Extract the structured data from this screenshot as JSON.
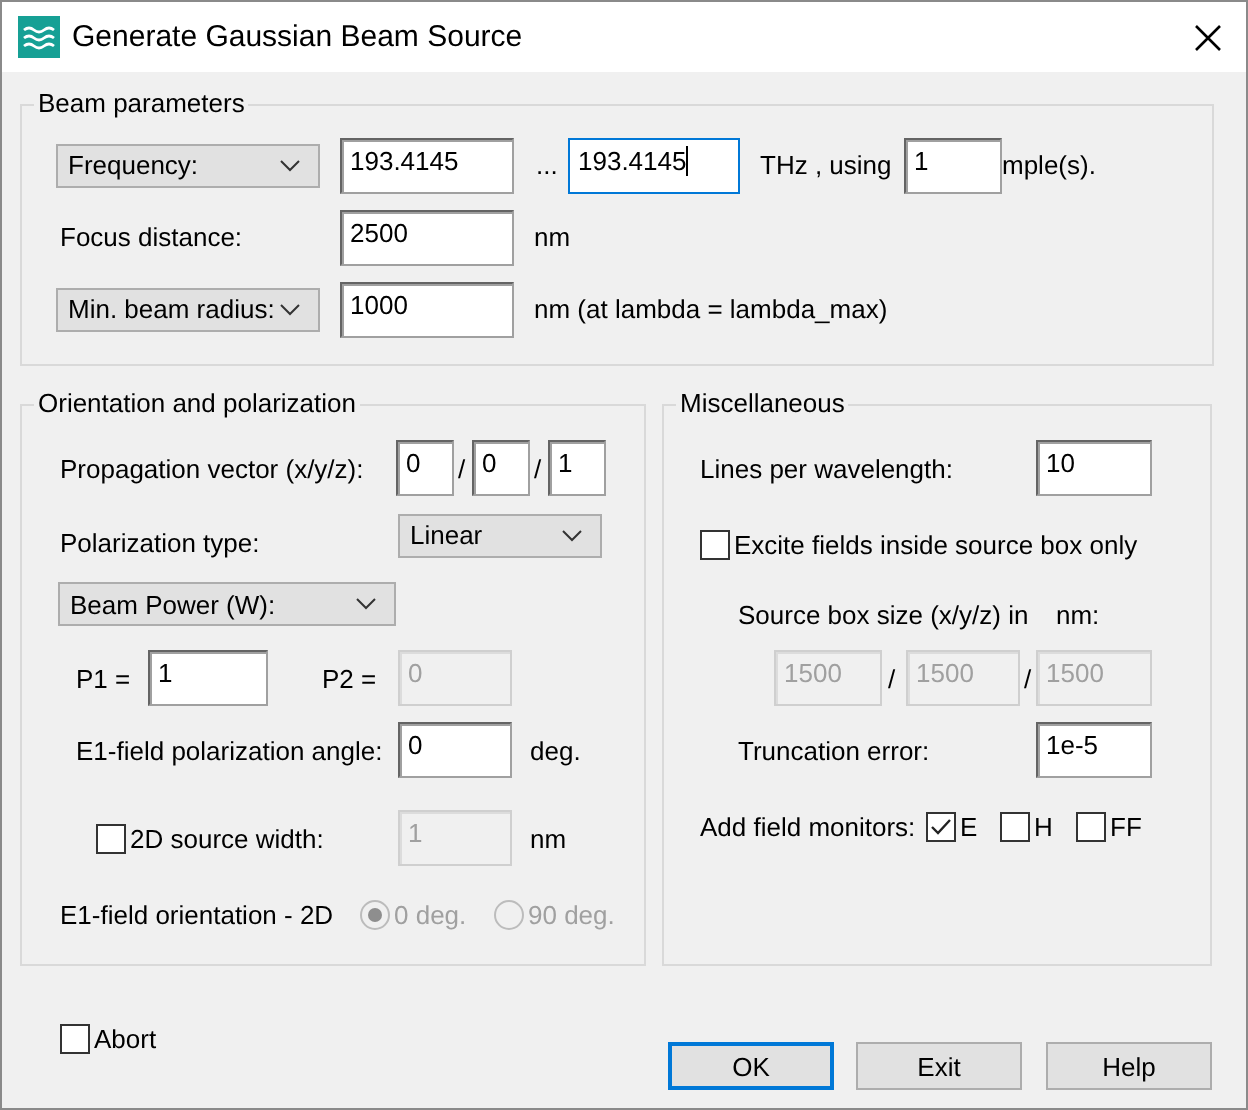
{
  "window": {
    "title": "Generate Gaussian Beam Source"
  },
  "beam_parameters": {
    "title": "Beam parameters",
    "frequency": {
      "mode": "Frequency:",
      "from": "193.4145",
      "separator": "...",
      "to": "193.4145",
      "to_focused": true,
      "unit": "THz , using",
      "samples": "1",
      "samples_suffix": "mple(s)."
    },
    "focus_distance": {
      "label": "Focus distance:",
      "value": "2500",
      "unit": "nm"
    },
    "beam_radius": {
      "mode": "Min. beam radius:",
      "value": "1000",
      "unit": "nm (at lambda = lambda_max)"
    }
  },
  "orientation": {
    "title": "Orientation and polarization",
    "propagation_vector": {
      "label": "Propagation vector (x/y/z):",
      "values": [
        "0",
        "0",
        "1"
      ],
      "separators": [
        "/",
        "/"
      ]
    },
    "polarization_type": {
      "label": "Polarization type:",
      "value": "Linear"
    },
    "power_mode": "Beam Power (W):",
    "p1": {
      "label": "P1 =",
      "value": "1",
      "disabled": false
    },
    "p2": {
      "label": "P2 =",
      "value": "0",
      "disabled": true
    },
    "angle": {
      "label": "E1-field polarization angle:",
      "value": "0",
      "unit": "deg."
    },
    "source_width": {
      "label": "2D source width:",
      "checked": false,
      "value": "1",
      "disabled": true,
      "unit": "nm"
    },
    "orientation_2d": {
      "label": "E1-field orientation - 2D",
      "disabled": true,
      "options": [
        {
          "label": "0 deg.",
          "selected": true
        },
        {
          "label": "90 deg.",
          "selected": false
        }
      ]
    }
  },
  "miscellaneous": {
    "title": "Miscellaneous",
    "lines_per_wavelength": {
      "label": "Lines per wavelength:",
      "value": "10"
    },
    "excite_inside_box": {
      "label": "Excite fields inside source box only",
      "checked": false
    },
    "source_box_size": {
      "label": "Source box size (x/y/z) in",
      "unit": "nm:",
      "values": [
        "1500",
        "1500",
        "1500"
      ],
      "separators": [
        "/",
        "/"
      ],
      "disabled": true
    },
    "truncation_error": {
      "label": "Truncation error:",
      "value": "1e-5"
    },
    "field_monitors": {
      "label": "Add field monitors:",
      "options": [
        {
          "label": "E",
          "checked": true
        },
        {
          "label": "H",
          "checked": false
        },
        {
          "label": "FF",
          "checked": false
        }
      ]
    }
  },
  "abort": {
    "label": "Abort",
    "checked": false
  },
  "buttons": [
    {
      "label": "OK",
      "default": true
    },
    {
      "label": "Exit",
      "default": false
    },
    {
      "label": "Help",
      "default": false
    }
  ]
}
